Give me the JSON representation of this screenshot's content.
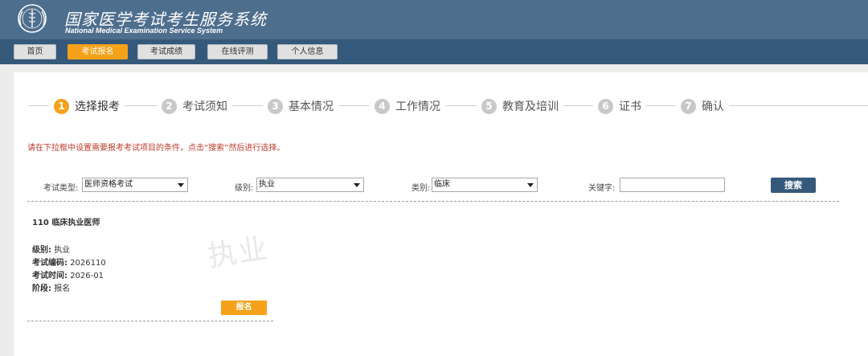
{
  "header": {
    "title": "国家医学考试考生服务系统",
    "subtitle": "National Medical Examination Service System",
    "colors": {
      "bar": "#4e6e8e",
      "nav": "#35597a",
      "accent": "#f5a21a"
    },
    "logo_icon": "emblem-logo"
  },
  "nav": {
    "items": [
      {
        "label": "首页",
        "active": false
      },
      {
        "label": "考试报名",
        "active": true
      },
      {
        "label": "考试成绩",
        "active": false
      },
      {
        "label": "在线评测",
        "active": false
      },
      {
        "label": "个人信息",
        "active": false
      }
    ]
  },
  "steps": [
    {
      "num": "1",
      "label": "选择报考",
      "active": true
    },
    {
      "num": "2",
      "label": "考试须知",
      "active": false
    },
    {
      "num": "3",
      "label": "基本情况",
      "active": false
    },
    {
      "num": "4",
      "label": "工作情况",
      "active": false
    },
    {
      "num": "5",
      "label": "教育及培训",
      "active": false
    },
    {
      "num": "6",
      "label": "证书",
      "active": false
    },
    {
      "num": "7",
      "label": "确认",
      "active": false
    }
  ],
  "notice": "请在下拉框中设置需要报考考试项目的条件，点击“搜索”然后进行选择。",
  "filters": {
    "exam_type": {
      "label": "考试类型:",
      "value": "医师资格考试"
    },
    "level": {
      "label": "级别:",
      "value": "执业"
    },
    "category": {
      "label": "类别:",
      "value": "临床"
    },
    "keyword": {
      "label": "关键字:",
      "value": ""
    },
    "search_label": "搜索"
  },
  "exam": {
    "title": "110 临床执业医师",
    "watermark": "执业",
    "rows": [
      {
        "key": "级别:",
        "value": "执业"
      },
      {
        "key": "考试编码:",
        "value": "2026110"
      },
      {
        "key": "考试时间:",
        "value": "2026-01"
      },
      {
        "key": "阶段:",
        "value": "报名"
      }
    ],
    "register_label": "报名"
  }
}
